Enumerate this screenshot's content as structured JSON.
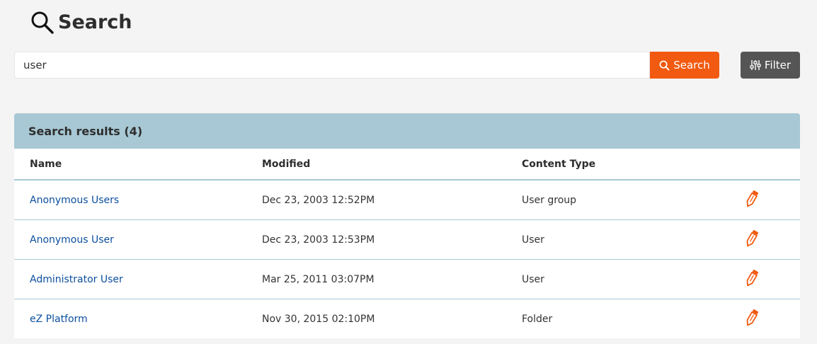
{
  "page": {
    "title": "Search",
    "title_icon": "search-icon"
  },
  "search": {
    "value": "user",
    "button_label": "Search",
    "button_icon": "search-icon",
    "button_color": "#f15a10"
  },
  "filter": {
    "button_label": "Filter",
    "button_icon": "sliders-icon",
    "button_color": "#555555"
  },
  "results": {
    "heading": "Search results (4)",
    "header_color": "#a7c8d4",
    "columns": [
      "Name",
      "Modified",
      "Content Type"
    ],
    "rows": [
      {
        "name": "Anonymous Users",
        "modified": "Dec 23, 2003 12:52PM",
        "content_type": "User group",
        "action_icon": "pencil-icon"
      },
      {
        "name": "Anonymous User",
        "modified": "Dec 23, 2003 12:53PM",
        "content_type": "User",
        "action_icon": "pencil-icon"
      },
      {
        "name": "Administrator User",
        "modified": "Mar 25, 2011 03:07PM",
        "content_type": "User",
        "action_icon": "pencil-icon"
      },
      {
        "name": "eZ Platform",
        "modified": "Nov 30, 2015 02:10PM",
        "content_type": "Folder",
        "action_icon": "pencil-icon"
      }
    ]
  },
  "colors": {
    "accent": "#f15a10",
    "link": "#0b4f9e",
    "background": "#f4f4f4"
  }
}
